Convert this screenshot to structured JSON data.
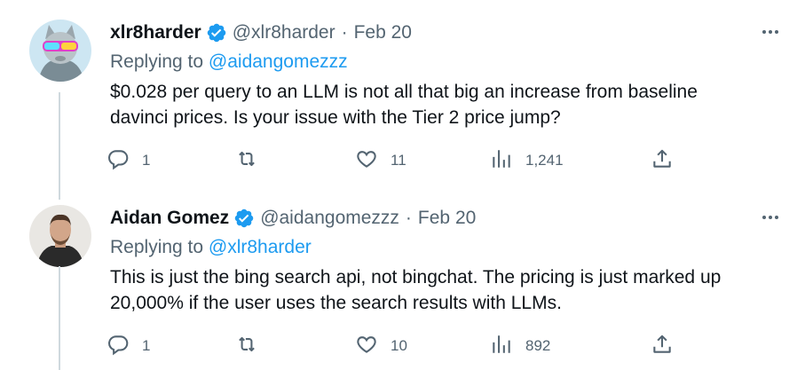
{
  "tweets": [
    {
      "name": "xlr8harder",
      "handle": "@xlr8harder",
      "separator": "·",
      "date": "Feb 20",
      "replying_prefix": "Replying to",
      "replying_to": "@aidangomezzz",
      "line1": "$0.028 per query to an LLM is not all that big an increase from baseline",
      "line2": "davinci prices. Is your issue with the Tier 2 price jump?",
      "replies": "1",
      "retweets": "",
      "likes": "11",
      "views": "1,241"
    },
    {
      "name": "Aidan Gomez",
      "handle": "@aidangomezzz",
      "separator": "·",
      "date": "Feb 20",
      "replying_prefix": "Replying to",
      "replying_to": "@xlr8harder",
      "line1": "This is just the bing search api, not bingchat. The pricing is just marked up",
      "line2": "20,000% if the user uses the search results with LLMs.",
      "replies": "1",
      "retweets": "",
      "likes": "10",
      "views": "892"
    }
  ],
  "colors": {
    "text": "#0f1419",
    "secondary": "#536471",
    "link": "#1d9bf0",
    "verified": "#1d9bf0",
    "thread_line": "#cfd9de"
  },
  "icons": [
    "reply-icon",
    "retweet-icon",
    "like-icon",
    "views-icon",
    "share-icon",
    "more-icon",
    "verified-icon"
  ]
}
